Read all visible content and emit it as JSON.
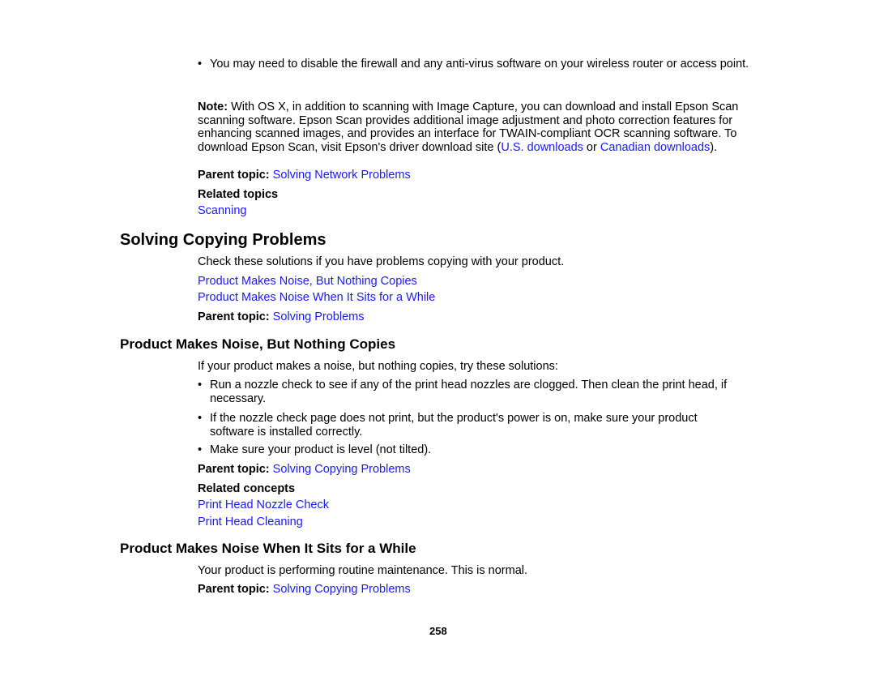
{
  "network_section": {
    "bullet": "You may need to disable the firewall and any anti-virus software on your wireless router or access point.",
    "note": {
      "label": "Note:",
      "text_before": " With OS X, in addition to scanning with Image Capture, you can download and install Epson Scan scanning software. Epson Scan provides additional image adjustment and photo correction features for enhancing scanned images, and provides an interface for TWAIN-compliant OCR scanning software. To download Epson Scan, visit Epson's driver download site (",
      "link_us": "U.S. downloads",
      "text_mid": " or ",
      "link_ca": "Canadian downloads",
      "text_after": ")."
    },
    "parent_topic_label": "Parent topic:",
    "parent_topic_link": "Solving Network Problems",
    "related_topics_label": "Related topics",
    "related_topics": [
      "Scanning"
    ]
  },
  "copying_section": {
    "title": "Solving Copying Problems",
    "intro": "Check these solutions if you have problems copying with your product.",
    "links": [
      "Product Makes Noise, But Nothing Copies",
      "Product Makes Noise When It Sits for a While"
    ],
    "parent_topic_label": "Parent topic:",
    "parent_topic_link": "Solving Problems"
  },
  "noise_nothing_copies": {
    "title": "Product Makes Noise, But Nothing Copies",
    "intro": "If your product makes a noise, but nothing copies, try these solutions:",
    "bullets": [
      "Run a nozzle check to see if any of the print head nozzles are clogged. Then clean the print head, if necessary.",
      "If the nozzle check page does not print, but the product's power is on, make sure your product software is installed correctly.",
      "Make sure your product is level (not tilted)."
    ],
    "parent_topic_label": "Parent topic:",
    "parent_topic_link": "Solving Copying Problems",
    "related_concepts_label": "Related concepts",
    "related_concepts": [
      "Print Head Nozzle Check",
      "Print Head Cleaning"
    ]
  },
  "noise_sits": {
    "title": "Product Makes Noise When It Sits for a While",
    "text": "Your product is performing routine maintenance. This is normal.",
    "parent_topic_label": "Parent topic:",
    "parent_topic_link": "Solving Copying Problems"
  },
  "page_number": "258",
  "bullet_char": "•",
  "colors": {
    "link": "#1a1aff",
    "text": "#000000"
  }
}
